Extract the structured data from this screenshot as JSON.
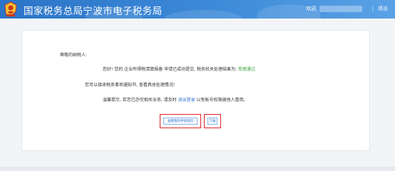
{
  "header": {
    "title": "国家税务总局宁波市电子税务局",
    "welcome": "欢迎,",
    "separator": "|",
    "logout": "退出"
  },
  "notice": {
    "greeting": "尊敬的纳税人:",
    "line1_prefix": "您好! 您的 企业所得税清算报备 申请已成功提交, 税务机关处理结果为:",
    "line1_status": "受理通过",
    "line2": "您可以接收税务事项通知书, 查看具体处理情况!",
    "line3_prefix": "温馨提示, 若您已办完相关业务, 请及时",
    "line3_link": "退出登录",
    "line3_suffix": "以免账号权限被他人冒用。"
  },
  "buttons": {
    "view_materials": "查看我的申请资料",
    "download": "下载"
  },
  "colors": {
    "header_blue": "#2b74c8",
    "status_green": "#3aa23a",
    "link_blue": "#2f74d0",
    "highlight_red": "#e0222b"
  },
  "icons": {
    "emblem": "tax-emblem-icon"
  }
}
